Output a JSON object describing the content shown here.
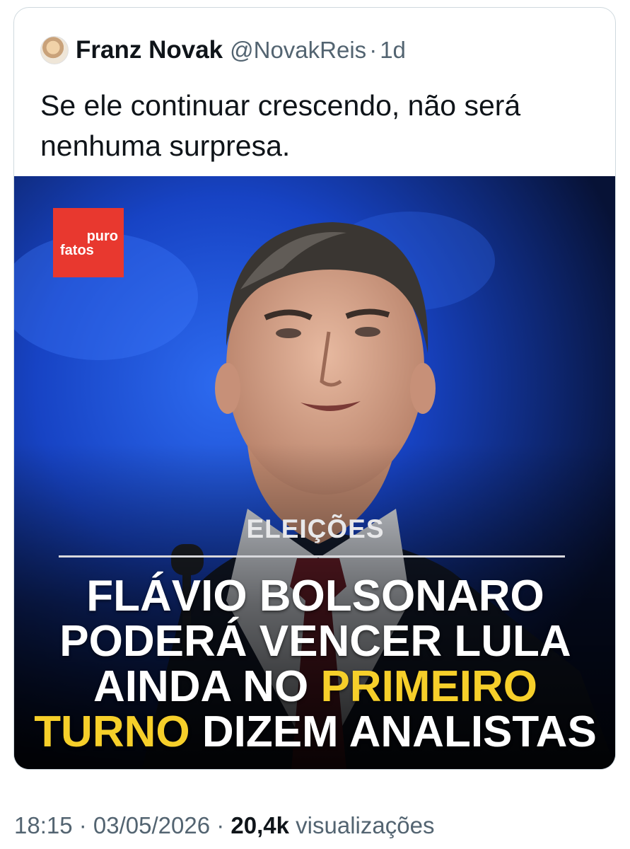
{
  "tweet": {
    "author_name": "Franz Novak",
    "handle": "@NovakReis",
    "separator": "·",
    "time_ago": "1d",
    "text": "Se ele continuar crescendo, não será nenhuma surpresa."
  },
  "media": {
    "logo": {
      "line1": "puro",
      "line2": "fatos"
    },
    "category": "ELEIÇÕES",
    "headline": {
      "line1": "FLÁVIO BOLSONARO",
      "line2": "PODERÁ VENCER LULA",
      "line3_white": "AINDA NO ",
      "line3_yellow": "PRIMEIRO",
      "line4_yellow": "TURNO",
      "line4_white": " DIZEM ANALISTAS"
    },
    "colors": {
      "highlight": "#f6cf2a",
      "logo_bg": "#e8382f"
    }
  },
  "meta": {
    "time": "18:15",
    "separator": " · ",
    "date": "03/05/2026",
    "views_count": "20,4k",
    "views_label": " visualizações"
  }
}
